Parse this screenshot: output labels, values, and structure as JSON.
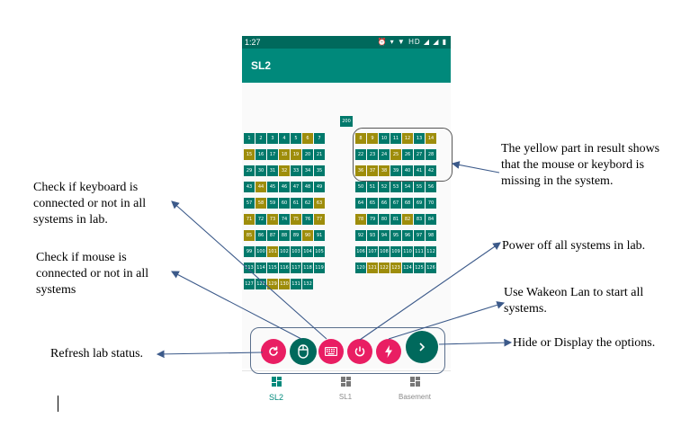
{
  "status_bar": {
    "time": "1:27",
    "icons": "⏰ ▾ ▼ HD ◢ ◢ ▮"
  },
  "app_bar": {
    "title": "SL2"
  },
  "lab": {
    "seats": [
      {
        "id": "200",
        "ok": true
      },
      {
        "id": "1",
        "ok": true
      },
      {
        "id": "2",
        "ok": true
      },
      {
        "id": "3",
        "ok": true
      },
      {
        "id": "4",
        "ok": true
      },
      {
        "id": "5",
        "ok": true
      },
      {
        "id": "6",
        "ok": false
      },
      {
        "id": "7",
        "ok": true
      },
      {
        "id": "8",
        "ok": false
      },
      {
        "id": "9",
        "ok": false
      },
      {
        "id": "10",
        "ok": true
      },
      {
        "id": "11",
        "ok": true
      },
      {
        "id": "12",
        "ok": false
      },
      {
        "id": "13",
        "ok": true
      },
      {
        "id": "14",
        "ok": false
      },
      {
        "id": "15",
        "ok": false
      },
      {
        "id": "16",
        "ok": true
      },
      {
        "id": "17",
        "ok": true
      },
      {
        "id": "18",
        "ok": false
      },
      {
        "id": "19",
        "ok": false
      },
      {
        "id": "20",
        "ok": true
      },
      {
        "id": "21",
        "ok": true
      },
      {
        "id": "22",
        "ok": true
      },
      {
        "id": "23",
        "ok": true
      },
      {
        "id": "24",
        "ok": true
      },
      {
        "id": "25",
        "ok": false
      },
      {
        "id": "26",
        "ok": true
      },
      {
        "id": "27",
        "ok": true
      },
      {
        "id": "28",
        "ok": true
      },
      {
        "id": "29",
        "ok": true
      },
      {
        "id": "30",
        "ok": true
      },
      {
        "id": "31",
        "ok": true
      },
      {
        "id": "32",
        "ok": false
      },
      {
        "id": "33",
        "ok": true
      },
      {
        "id": "34",
        "ok": true
      },
      {
        "id": "35",
        "ok": true
      },
      {
        "id": "36",
        "ok": false
      },
      {
        "id": "37",
        "ok": false
      },
      {
        "id": "38",
        "ok": false
      },
      {
        "id": "39",
        "ok": true
      },
      {
        "id": "40",
        "ok": true
      },
      {
        "id": "41",
        "ok": true
      },
      {
        "id": "42",
        "ok": true
      },
      {
        "id": "43",
        "ok": true
      },
      {
        "id": "44",
        "ok": false
      },
      {
        "id": "45",
        "ok": true
      },
      {
        "id": "46",
        "ok": true
      },
      {
        "id": "47",
        "ok": true
      },
      {
        "id": "48",
        "ok": true
      },
      {
        "id": "49",
        "ok": true
      },
      {
        "id": "50",
        "ok": true
      },
      {
        "id": "51",
        "ok": true
      },
      {
        "id": "52",
        "ok": true
      },
      {
        "id": "53",
        "ok": true
      },
      {
        "id": "54",
        "ok": true
      },
      {
        "id": "55",
        "ok": true
      },
      {
        "id": "56",
        "ok": true
      },
      {
        "id": "57",
        "ok": true
      },
      {
        "id": "58",
        "ok": false
      },
      {
        "id": "59",
        "ok": true
      },
      {
        "id": "60",
        "ok": true
      },
      {
        "id": "61",
        "ok": true
      },
      {
        "id": "62",
        "ok": true
      },
      {
        "id": "63",
        "ok": false
      },
      {
        "id": "64",
        "ok": true
      },
      {
        "id": "65",
        "ok": true
      },
      {
        "id": "66",
        "ok": true
      },
      {
        "id": "67",
        "ok": true
      },
      {
        "id": "68",
        "ok": true
      },
      {
        "id": "69",
        "ok": true
      },
      {
        "id": "70",
        "ok": true
      },
      {
        "id": "71",
        "ok": false
      },
      {
        "id": "72",
        "ok": true
      },
      {
        "id": "73",
        "ok": false
      },
      {
        "id": "74",
        "ok": true
      },
      {
        "id": "75",
        "ok": false
      },
      {
        "id": "76",
        "ok": true
      },
      {
        "id": "77",
        "ok": false
      },
      {
        "id": "78",
        "ok": false
      },
      {
        "id": "79",
        "ok": true
      },
      {
        "id": "80",
        "ok": true
      },
      {
        "id": "81",
        "ok": true
      },
      {
        "id": "82",
        "ok": false
      },
      {
        "id": "83",
        "ok": true
      },
      {
        "id": "84",
        "ok": true
      },
      {
        "id": "85",
        "ok": false
      },
      {
        "id": "86",
        "ok": true
      },
      {
        "id": "87",
        "ok": true
      },
      {
        "id": "88",
        "ok": true
      },
      {
        "id": "89",
        "ok": true
      },
      {
        "id": "90",
        "ok": false
      },
      {
        "id": "91",
        "ok": true
      },
      {
        "id": "92",
        "ok": true
      },
      {
        "id": "93",
        "ok": true
      },
      {
        "id": "94",
        "ok": true
      },
      {
        "id": "95",
        "ok": true
      },
      {
        "id": "96",
        "ok": true
      },
      {
        "id": "97",
        "ok": true
      },
      {
        "id": "98",
        "ok": true
      },
      {
        "id": "99",
        "ok": true
      },
      {
        "id": "100",
        "ok": true
      },
      {
        "id": "101",
        "ok": false
      },
      {
        "id": "102",
        "ok": true
      },
      {
        "id": "103",
        "ok": true
      },
      {
        "id": "104",
        "ok": true
      },
      {
        "id": "105",
        "ok": true
      },
      {
        "id": "106",
        "ok": true
      },
      {
        "id": "107",
        "ok": true
      },
      {
        "id": "108",
        "ok": true
      },
      {
        "id": "109",
        "ok": true
      },
      {
        "id": "110",
        "ok": true
      },
      {
        "id": "111",
        "ok": true
      },
      {
        "id": "112",
        "ok": true
      },
      {
        "id": "113",
        "ok": true
      },
      {
        "id": "114",
        "ok": true
      },
      {
        "id": "115",
        "ok": true
      },
      {
        "id": "116",
        "ok": true
      },
      {
        "id": "117",
        "ok": true
      },
      {
        "id": "118",
        "ok": true
      },
      {
        "id": "119",
        "ok": true
      },
      {
        "id": "120",
        "ok": true
      },
      {
        "id": "121",
        "ok": false
      },
      {
        "id": "122",
        "ok": false
      },
      {
        "id": "123",
        "ok": false
      },
      {
        "id": "124",
        "ok": true
      },
      {
        "id": "125",
        "ok": true
      },
      {
        "id": "126",
        "ok": true
      },
      {
        "id": "127",
        "ok": true
      },
      {
        "id": "128",
        "ok": true
      },
      {
        "id": "129",
        "ok": false
      },
      {
        "id": "130",
        "ok": false
      },
      {
        "id": "131",
        "ok": true
      },
      {
        "id": "132",
        "ok": true
      }
    ]
  },
  "fab_actions": [
    {
      "name": "refresh",
      "icon": "refresh-icon"
    },
    {
      "name": "mouse-check",
      "icon": "mouse-icon"
    },
    {
      "name": "keyboard-check",
      "icon": "keyboard-icon"
    },
    {
      "name": "power-off",
      "icon": "power-icon"
    },
    {
      "name": "wakeon-lan",
      "icon": "flash-icon"
    },
    {
      "name": "toggle-options",
      "icon": "chevron-right-icon"
    }
  ],
  "bottom_nav": [
    {
      "label": "SL2",
      "active": true
    },
    {
      "label": "SL1",
      "active": false
    },
    {
      "label": "Basement",
      "active": false
    }
  ],
  "annotations": {
    "yellow_part": [
      "The yellow part in result shows",
      "that the mouse or keybord is",
      "missing  in the system."
    ],
    "keyboard": [
      "Check if keyboard is",
      "connected or not in all",
      "systems in lab."
    ],
    "mouse": [
      "Check if mouse is",
      "connected or not in all",
      "systems"
    ],
    "power": [
      "Power off all systems in lab."
    ],
    "wakeon": [
      "Use Wakeon Lan to start all",
      "systems."
    ],
    "refresh": [
      "Refresh lab status."
    ],
    "hide": [
      "Hide or Display the options."
    ]
  },
  "colors": {
    "ok": "#00796b",
    "missing": "#9e8d0b",
    "appbar": "#00897b",
    "statusbar": "#00695c",
    "fab": "#e91e63",
    "arrow": "#3c5a8a"
  }
}
